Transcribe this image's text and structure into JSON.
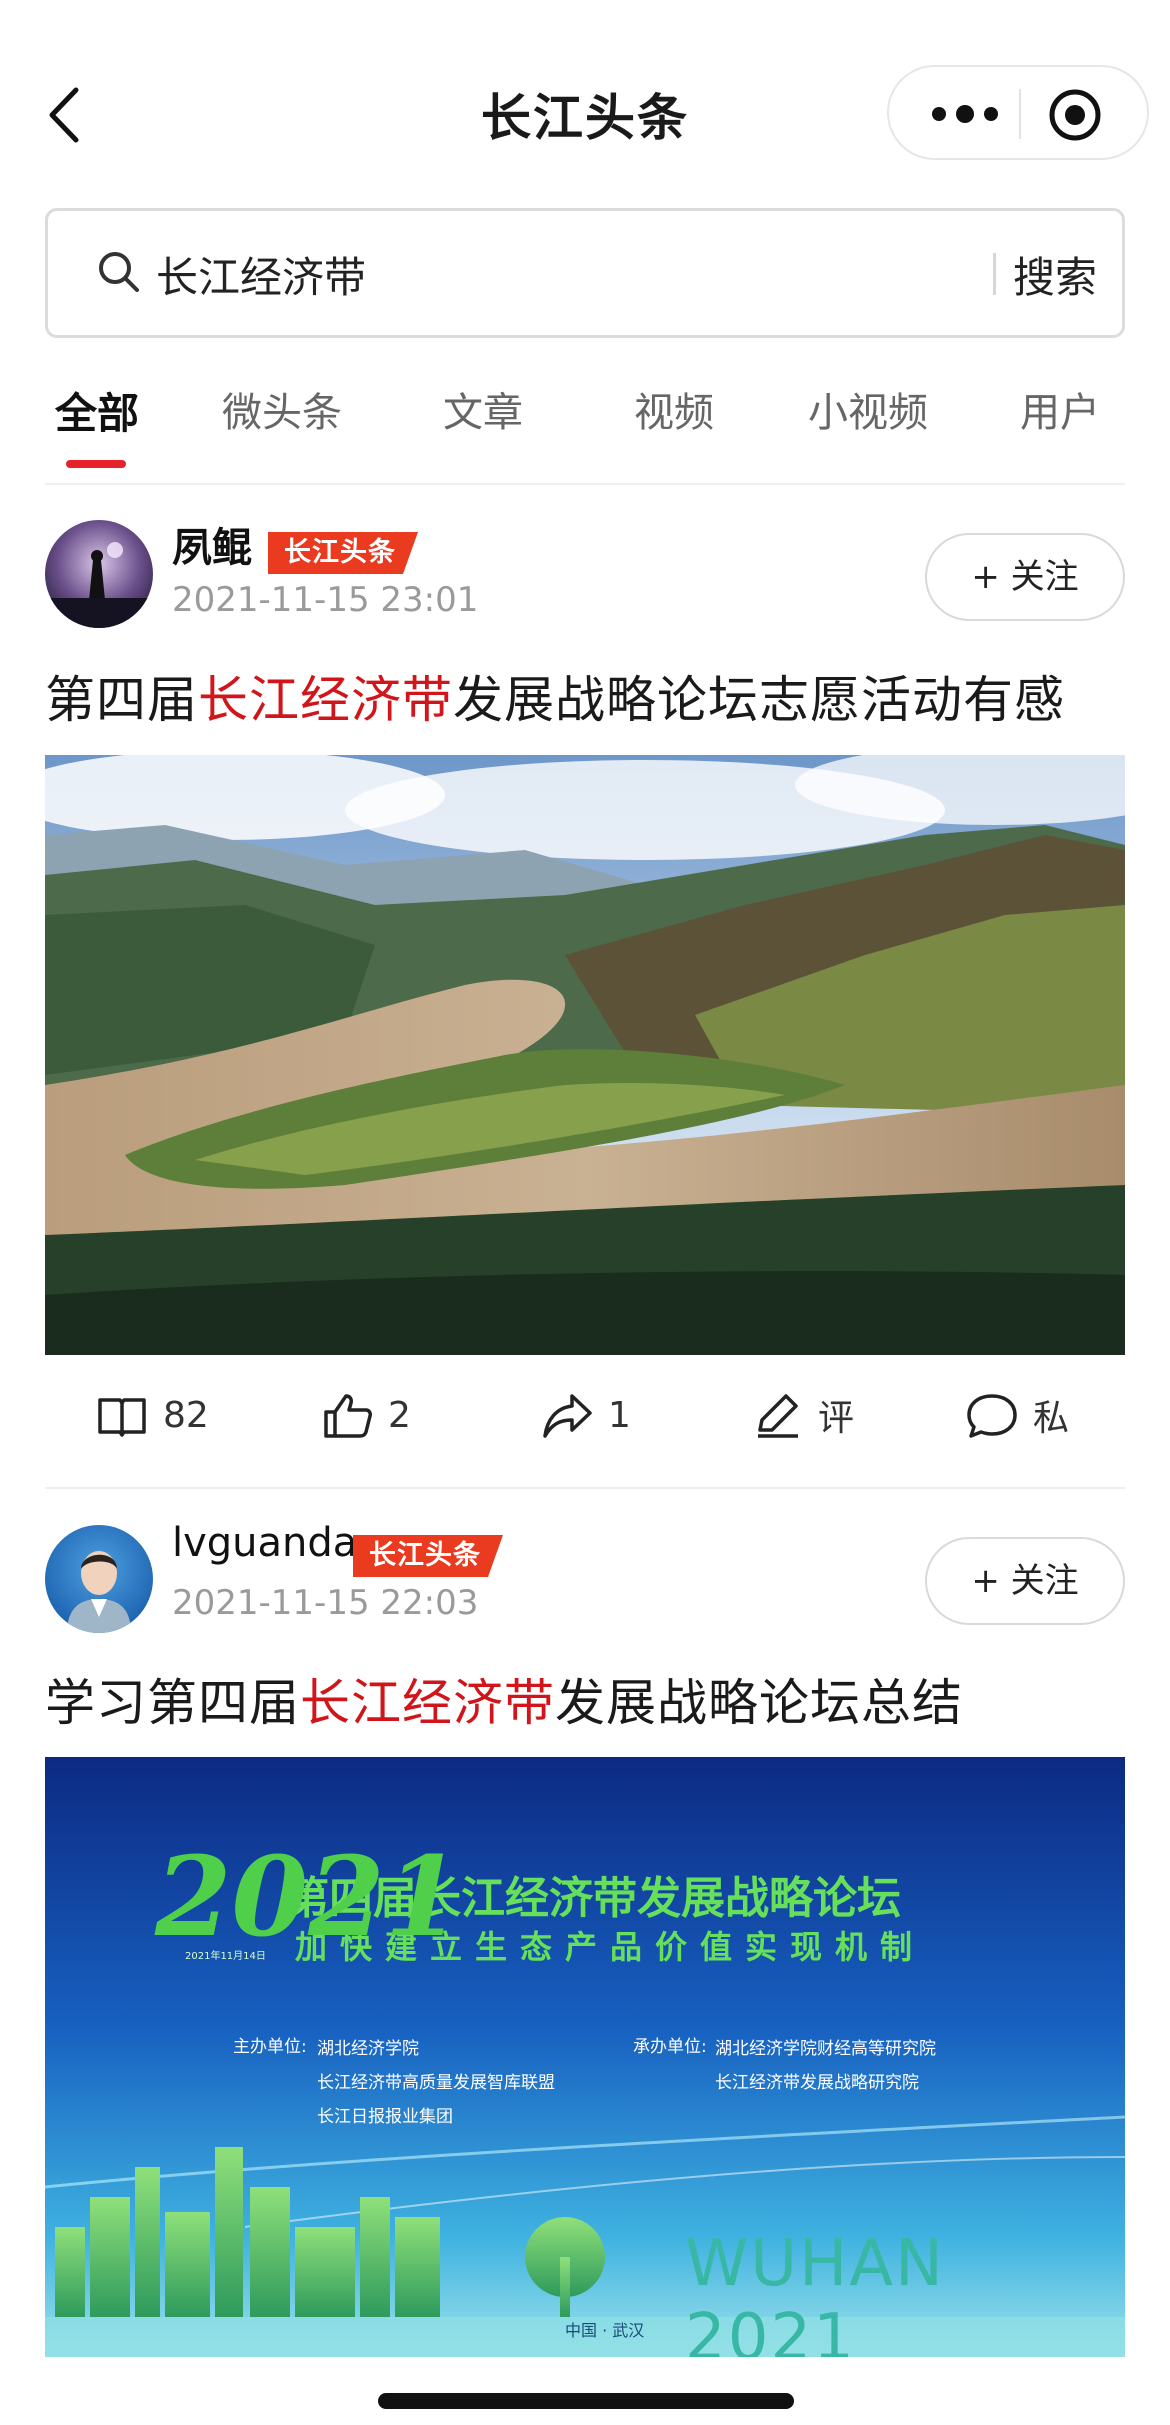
{
  "nav": {
    "title": "长江头条",
    "icons": [
      "back-icon",
      "more-dots-icon",
      "target-icon"
    ]
  },
  "search": {
    "value": "长江经济带",
    "button_label": "搜索"
  },
  "tabs": [
    {
      "label": "全部",
      "active": true
    },
    {
      "label": "微头条",
      "active": false
    },
    {
      "label": "文章",
      "active": false
    },
    {
      "label": "视频",
      "active": false
    },
    {
      "label": "小视频",
      "active": false
    },
    {
      "label": "用户",
      "active": false
    }
  ],
  "posts": [
    {
      "author": "夙鲲",
      "badge": "长江头条",
      "time": "2021-11-15 23:01",
      "follow_label": "+ 关注",
      "title_pre": "第四届",
      "title_hl": "长江经济带",
      "title_post": "发展战略论坛志愿活动有感",
      "stats": {
        "reads": "82",
        "likes": "2",
        "shares": "1",
        "comment_label": "评",
        "message_label": "私"
      }
    },
    {
      "author": "lvguanda",
      "badge": "长江头条",
      "time": "2021-11-15 22:03",
      "follow_label": "+ 关注",
      "title_pre": "学习第四届",
      "title_hl": "长江经济带",
      "title_post": "发展战略论坛总结",
      "banner": {
        "main_title": "第四届长江经济带发展战略论坛",
        "subtitle": "加快建立生态产品价值实现机制",
        "year": "2021",
        "date_small": "2021年11月14日",
        "host_label": "主办单位:",
        "hosts": [
          "湖北经济学院",
          "长江经济带高质量发展智库联盟",
          "长江日报报业集团"
        ],
        "organizer_label": "承办单位:",
        "organizers": [
          "湖北经济学院财经高等研究院",
          "长江经济带发展战略研究院"
        ],
        "city_text": "WUHAN 2021",
        "location": "中国 · 武汉"
      }
    }
  ],
  "colors": {
    "accent": "#e6212a",
    "highlight": "#d0161b",
    "badge": "#ea3a1f",
    "muted": "#9a9a9a"
  }
}
